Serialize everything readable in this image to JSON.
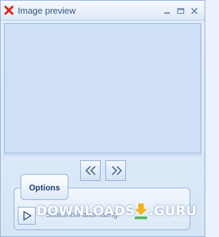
{
  "window": {
    "title": "Image preview",
    "controls": {
      "minimize_icon": "minimize-icon",
      "maximize_icon": "maximize-icon",
      "close_icon": "close-icon"
    }
  },
  "navigation": {
    "previous_icon": "double-chevron-left-icon",
    "next_icon": "double-chevron-right-icon"
  },
  "options": {
    "tab_label": "Options",
    "play_icon": "play-icon",
    "slideshow_text": "Slideshow alternating"
  },
  "watermark": {
    "left_text": "DOWNLOADS",
    "right_text": ".GURU"
  },
  "colors": {
    "accent": "#8fb0d8",
    "preview_background": "#cfe0f6",
    "title_text": "#34557f",
    "close_red": "#e0241b"
  }
}
